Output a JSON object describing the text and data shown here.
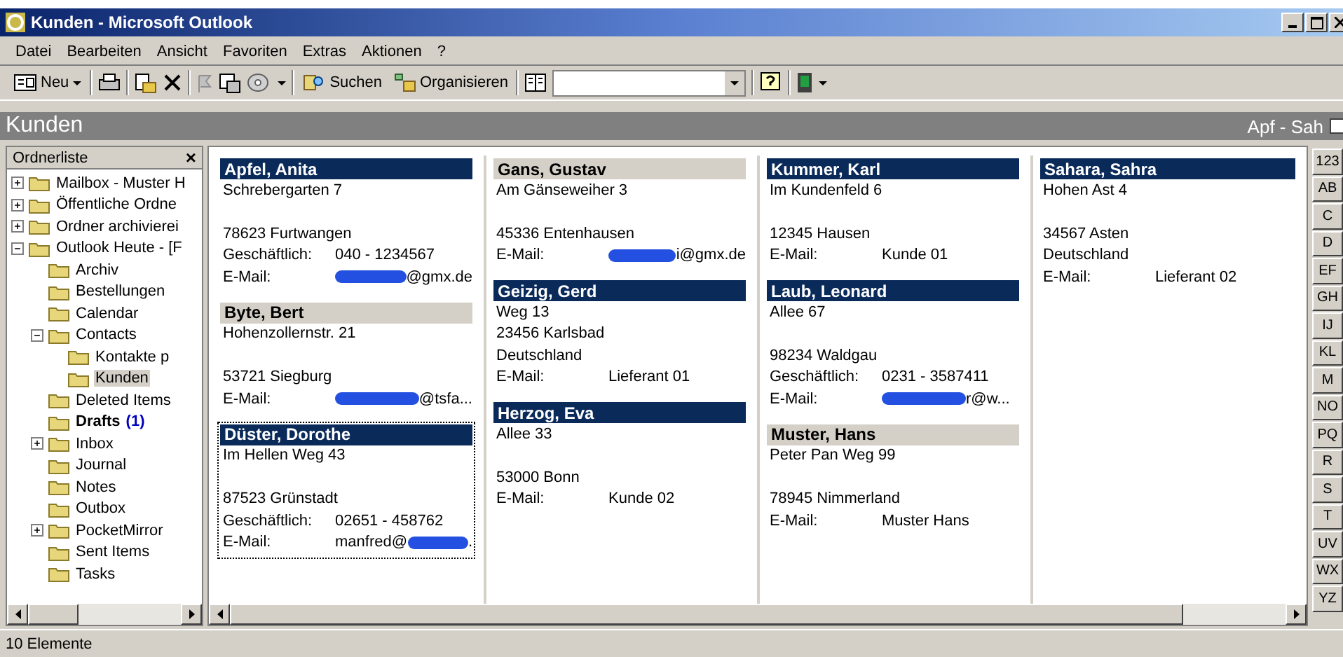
{
  "window": {
    "title": "Kunden - Microsoft Outlook"
  },
  "menu": [
    "Datei",
    "Bearbeiten",
    "Ansicht",
    "Favoriten",
    "Extras",
    "Aktionen",
    "?"
  ],
  "toolbar": {
    "new_label": "Neu",
    "find_label": "Suchen",
    "organize_label": "Organisieren"
  },
  "folder_bar": {
    "title": "Kunden",
    "range": "Apf - Sah"
  },
  "folder_pane": {
    "title": "Ordnerliste",
    "close": "×",
    "tree": [
      {
        "label": "Mailbox - Muster H",
        "expanded": false,
        "selected": false
      },
      {
        "label": "Öffentliche Ordne",
        "expanded": false,
        "selected": false
      },
      {
        "label": "Ordner archivierei",
        "expanded": false,
        "selected": false
      },
      {
        "label": "Outlook Heute - [F",
        "expanded": true,
        "selected": false,
        "children": [
          {
            "label": "Archiv",
            "selected": false
          },
          {
            "label": "Bestellungen",
            "selected": false
          },
          {
            "label": "Calendar",
            "selected": false
          },
          {
            "label": "Contacts",
            "expanded": true,
            "selected": false,
            "children": [
              {
                "label": "Kontakte p",
                "selected": false
              },
              {
                "label": "Kunden",
                "selected": true
              }
            ]
          },
          {
            "label": "Deleted Items",
            "selected": false
          },
          {
            "label": "Drafts",
            "count": "(1)",
            "selected": false
          },
          {
            "label": "Inbox",
            "expanded": false,
            "selected": false
          },
          {
            "label": "Journal",
            "selected": false
          },
          {
            "label": "Notes",
            "selected": false
          },
          {
            "label": "Outbox",
            "selected": false
          },
          {
            "label": "PocketMirror",
            "expanded": false,
            "selected": false
          },
          {
            "label": "Sent Items",
            "selected": false
          },
          {
            "label": "Tasks",
            "selected": false
          }
        ]
      }
    ]
  },
  "columns": [
    [
      {
        "name": "Apfel, Anita",
        "selected": true,
        "focused": false,
        "lines": [
          {
            "kind": "text",
            "text": "Schrebergarten 7"
          },
          {
            "kind": "gap"
          },
          {
            "kind": "text",
            "text": "78623 Furtwangen"
          },
          {
            "kind": "field",
            "label": "Geschäftlich:",
            "value": "040 - 1234567"
          },
          {
            "kind": "email",
            "label": "E-Mail:",
            "after": "@gmx.de"
          }
        ]
      },
      {
        "name": "Byte, Bert",
        "selected": false,
        "focused": false,
        "lines": [
          {
            "kind": "text",
            "text": "Hohenzollernstr. 21"
          },
          {
            "kind": "gap"
          },
          {
            "kind": "text",
            "text": "53721 Siegburg"
          },
          {
            "kind": "email",
            "label": "E-Mail:",
            "after": "@tsfa..."
          }
        ]
      },
      {
        "name": "Düster, Dorothe",
        "selected": true,
        "focused": true,
        "lines": [
          {
            "kind": "text",
            "text": "Im Hellen Weg 43"
          },
          {
            "kind": "gap"
          },
          {
            "kind": "text",
            "text": "87523 Grünstadt"
          },
          {
            "kind": "field",
            "label": "Geschäftlich:",
            "value": "02651 - 458762"
          },
          {
            "kind": "email",
            "label": "E-Mail:",
            "before": "manfred@",
            "after": "."
          }
        ]
      }
    ],
    [
      {
        "name": "Gans, Gustav",
        "selected": false,
        "focused": false,
        "lines": [
          {
            "kind": "text",
            "text": "Am Gänseweiher 3"
          },
          {
            "kind": "gap"
          },
          {
            "kind": "text",
            "text": "45336 Entenhausen"
          },
          {
            "kind": "email",
            "label": "E-Mail:",
            "after": "i@gmx.de"
          }
        ]
      },
      {
        "name": "Geizig, Gerd",
        "selected": true,
        "focused": false,
        "lines": [
          {
            "kind": "text",
            "text": "Weg 13"
          },
          {
            "kind": "text",
            "text": "23456  Karlsbad"
          },
          {
            "kind": "text",
            "text": "Deutschland"
          },
          {
            "kind": "field",
            "label": "E-Mail:",
            "value": "Lieferant 01"
          }
        ]
      },
      {
        "name": "Herzog, Eva",
        "selected": true,
        "focused": false,
        "lines": [
          {
            "kind": "text",
            "text": "Allee 33"
          },
          {
            "kind": "gap"
          },
          {
            "kind": "text",
            "text": "53000 Bonn"
          },
          {
            "kind": "field",
            "label": "E-Mail:",
            "value": "Kunde 02"
          }
        ]
      }
    ],
    [
      {
        "name": "Kummer, Karl",
        "selected": true,
        "focused": false,
        "lines": [
          {
            "kind": "text",
            "text": "Im Kundenfeld 6"
          },
          {
            "kind": "gap"
          },
          {
            "kind": "text",
            "text": "12345 Hausen"
          },
          {
            "kind": "field",
            "label": "E-Mail:",
            "value": "Kunde 01"
          }
        ]
      },
      {
        "name": "Laub, Leonard",
        "selected": true,
        "focused": false,
        "lines": [
          {
            "kind": "text",
            "text": "Allee 67"
          },
          {
            "kind": "gap"
          },
          {
            "kind": "text",
            "text": "98234 Waldgau"
          },
          {
            "kind": "field",
            "label": "Geschäftlich:",
            "value": "0231 - 3587411"
          },
          {
            "kind": "email",
            "label": "E-Mail:",
            "after": "r@w..."
          }
        ]
      },
      {
        "name": "Muster, Hans",
        "selected": false,
        "focused": false,
        "lines": [
          {
            "kind": "text",
            "text": "Peter Pan Weg 99"
          },
          {
            "kind": "gap"
          },
          {
            "kind": "text",
            "text": "78945 Nimmerland"
          },
          {
            "kind": "field",
            "label": "E-Mail:",
            "value": "Muster Hans"
          }
        ]
      }
    ],
    [
      {
        "name": "Sahara, Sahra",
        "selected": true,
        "focused": false,
        "lines": [
          {
            "kind": "text",
            "text": "Hohen Ast 4"
          },
          {
            "kind": "gap"
          },
          {
            "kind": "text",
            "text": "34567  Asten"
          },
          {
            "kind": "text",
            "text": "Deutschland"
          },
          {
            "kind": "field",
            "label": "E-Mail:",
            "value": "Lieferant 02"
          }
        ]
      }
    ]
  ],
  "index_buttons": [
    "123",
    "AB",
    "C",
    "D",
    "EF",
    "GH",
    "IJ",
    "KL",
    "M",
    "NO",
    "PQ",
    "R",
    "S",
    "T",
    "UV",
    "WX",
    "YZ"
  ],
  "status_bar": "10 Elemente"
}
